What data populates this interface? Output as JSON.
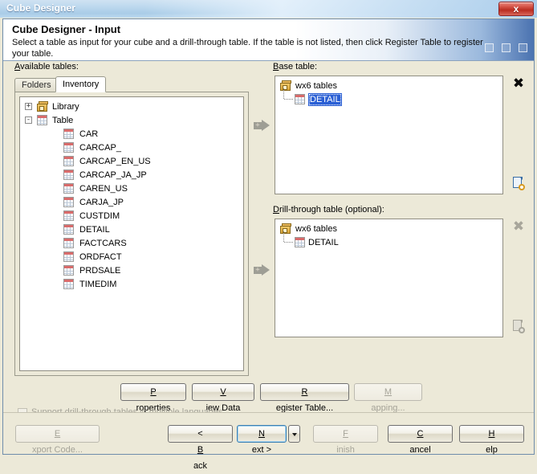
{
  "window": {
    "title": "Cube Designer",
    "close_label": "x"
  },
  "banner": {
    "title": "Cube Designer - Input",
    "description": "Select a table as input for your cube and a drill-through table. If the table is not listed, then click Register Table to register your table."
  },
  "left_panel": {
    "label_prefix": "A",
    "label_rest": "vailable tables:",
    "tabs": [
      {
        "label": "Folders",
        "active": false
      },
      {
        "label": "Inventory",
        "active": true
      }
    ],
    "tree": {
      "root_nodes": [
        {
          "label": "Library",
          "icon": "library-icon",
          "expander": "+",
          "expanded": false
        },
        {
          "label": "Table",
          "icon": "table-icon",
          "expander": "-",
          "expanded": true
        }
      ],
      "tables": [
        "CAR",
        "CARCAP_",
        "CARCAP_EN_US",
        "CARCAP_JA_JP",
        "CAREN_US",
        "CARJA_JP",
        "CUSTDIM",
        "DETAIL",
        "FACTCARS",
        "ORDFACT",
        "PRDSALE",
        "TIMEDIM"
      ]
    }
  },
  "base_table": {
    "label_prefix": "B",
    "label_rest": "ase table:",
    "root": "wx6 tables",
    "item": "DETAIL",
    "item_selected": true,
    "remove_icon": "close-x-icon",
    "remove_enabled": true,
    "properties_icon": "document-gear-icon",
    "properties_enabled": true
  },
  "drillthrough_table": {
    "label_prefix": "D",
    "label_rest": "rill-through table (optional):",
    "root": "wx6 tables",
    "item": "DETAIL",
    "item_selected": false,
    "remove_icon": "close-x-icon",
    "remove_enabled": false,
    "properties_icon": "document-gear-icon",
    "properties_enabled": false
  },
  "transfer_buttons": {
    "to_base": "add-to-base-table-arrow",
    "to_drillthrough": "add-to-drillthrough-arrow"
  },
  "action_buttons": [
    {
      "prefix": "P",
      "rest": "roperties",
      "enabled": true,
      "name": "properties-button"
    },
    {
      "prefix": "V",
      "rest": "iew Data",
      "enabled": true,
      "name": "view-data-button"
    },
    {
      "prefix": "R",
      "rest": "egister Table...",
      "enabled": true,
      "name": "register-table-button"
    },
    {
      "prefix": "M",
      "rest": "apping...",
      "enabled": false,
      "name": "mapping-button"
    }
  ],
  "checkbox": {
    "label": "Support drill-through tables in multiple languages",
    "checked": false,
    "enabled": false
  },
  "footer_buttons": {
    "export_code": {
      "prefix": "E",
      "rest": "xport Code...",
      "enabled": false
    },
    "back": {
      "prefix": "< ",
      "mnem": "B",
      "rest": "ack",
      "enabled": true
    },
    "next": {
      "prefix": "",
      "mnem": "N",
      "rest": "ext >",
      "enabled": true,
      "focused": true
    },
    "next_dropdown": "next-dropdown-arrow",
    "finish": {
      "prefix": "",
      "mnem": "F",
      "rest": "inish",
      "enabled": false
    },
    "cancel": {
      "prefix": "",
      "mnem": "C",
      "rest": "ancel",
      "enabled": true
    },
    "help": {
      "prefix": "",
      "mnem": "H",
      "rest": "elp",
      "enabled": true
    }
  },
  "colors": {
    "dialog_bg": "#ece9d8",
    "selection_blue": "#2a5fd4",
    "banner_accent": "#4a72b0",
    "close_red": "#b92d21"
  }
}
